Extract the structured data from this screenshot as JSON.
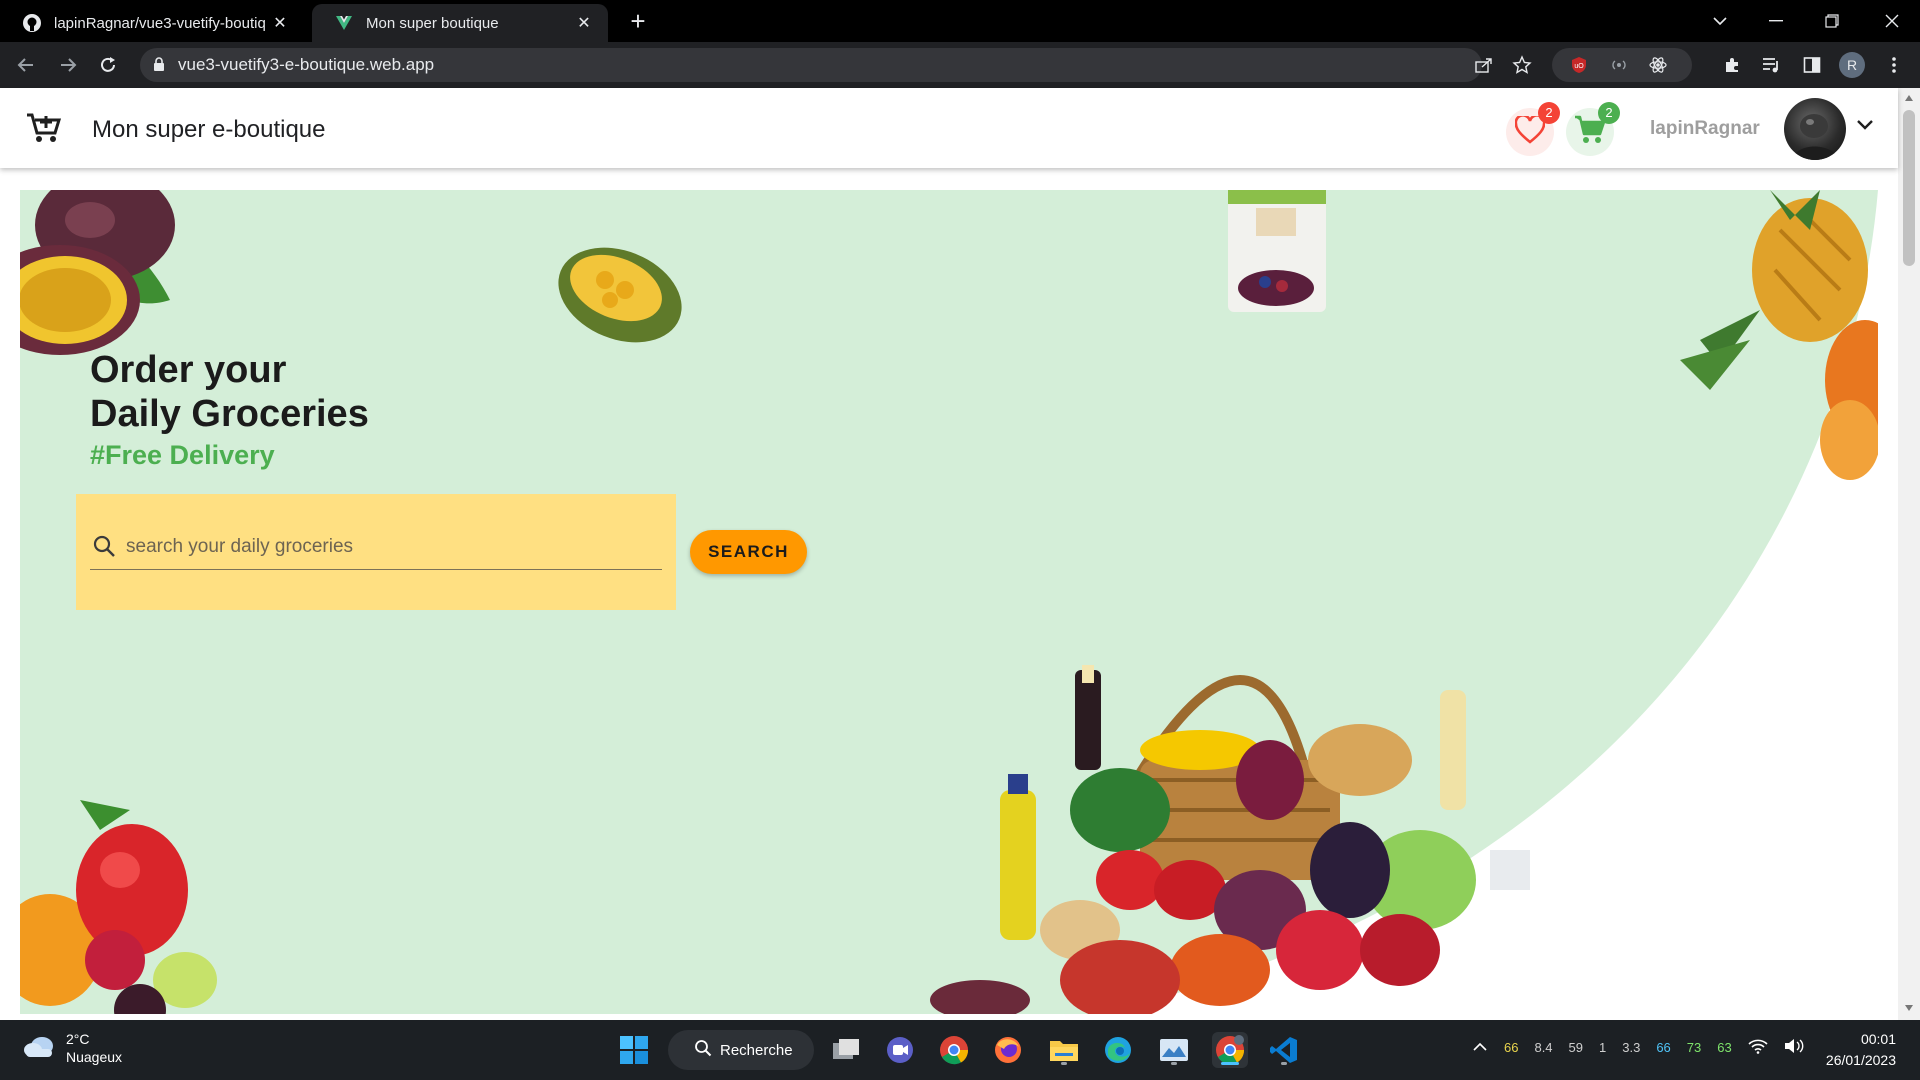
{
  "browser": {
    "tabs": [
      {
        "title": "lapinRagnar/vue3-vuetify-boutiq",
        "active": false,
        "icon": "github-icon"
      },
      {
        "title": "Mon super boutique",
        "active": true,
        "icon": "vue-icon"
      }
    ],
    "url": "vue3-vuetify3-e-boutique.web.app",
    "profile_initial": "R"
  },
  "app": {
    "title": "Mon super e-boutique",
    "favorites_count": "2",
    "cart_count": "2",
    "username": "lapinRagnar",
    "colors": {
      "favorite": "#f44336",
      "cart": "#4caf50",
      "accent": "#ff9800",
      "hero_bg": "#d4eed8"
    }
  },
  "hero": {
    "line1": "Order your",
    "line2": "Daily Groceries",
    "tagline": "#Free Delivery",
    "search_placeholder": "search your daily groceries",
    "search_button": "SEARCH"
  },
  "taskbar": {
    "weather_temp": "2°C",
    "weather_desc": "Nuageux",
    "search_label": "Recherche",
    "tray_stats": [
      "66",
      "8.4",
      "59",
      "1",
      "3.3",
      "66",
      "73",
      "63"
    ],
    "tray_colors": [
      "#e8d44d",
      "#cfcfcf",
      "#cfcfcf",
      "#cfcfcf",
      "#cfcfcf",
      "#4fc3f7",
      "#7ee36b",
      "#7ee36b"
    ],
    "time": "00:01",
    "date": "26/01/2023"
  }
}
